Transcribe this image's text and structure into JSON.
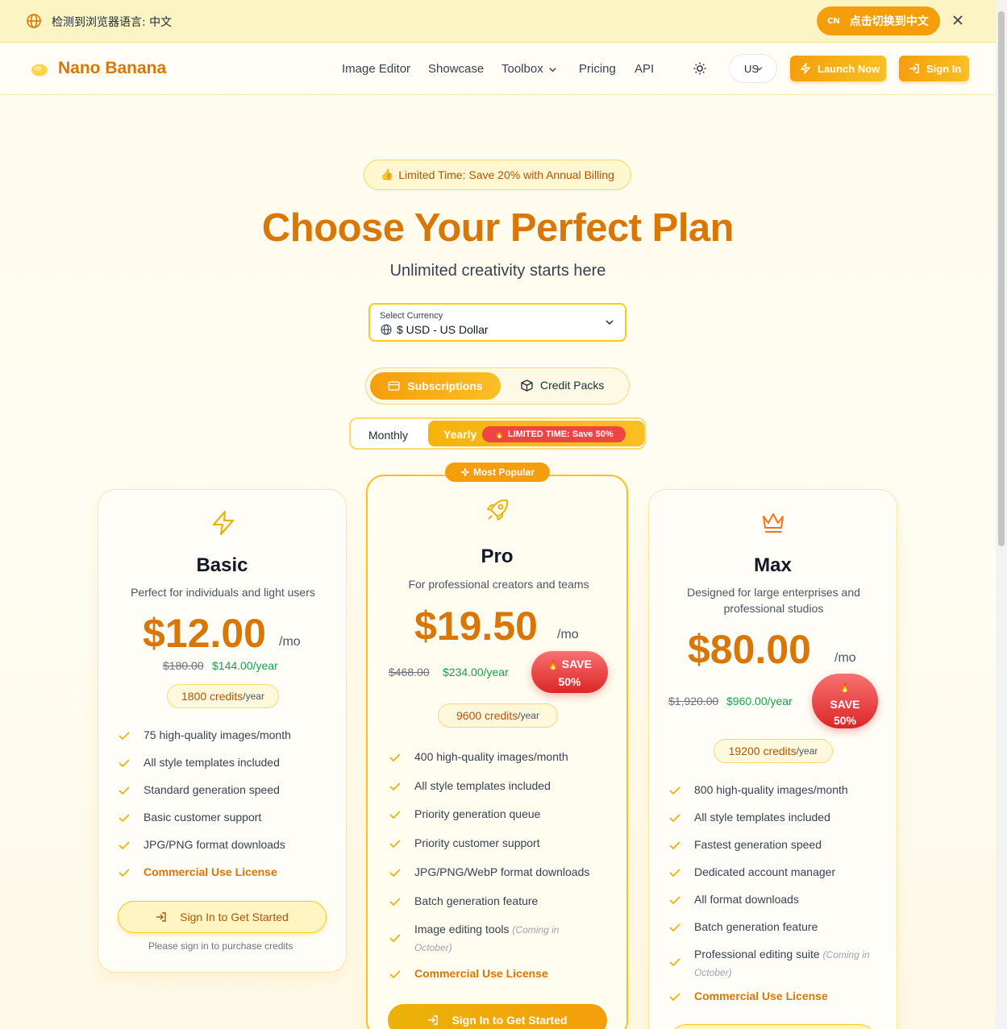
{
  "banner": {
    "text": "检测到浏览器语言: 中文",
    "switch_code": "CN",
    "switch_label": "点击切换到中文"
  },
  "header": {
    "brand": "Nano Banana",
    "nav": [
      "Image Editor",
      "Showcase",
      "Toolbox",
      "Pricing",
      "API"
    ],
    "lang_value": "US",
    "launch_label": "Launch Now",
    "signin_label": "Sign In"
  },
  "hero": {
    "promo": "Limited Time: Save 20% with Annual Billing",
    "title": "Choose Your Perfect Plan",
    "subtitle": "Unlimited creativity starts here",
    "currency_label": "Select Currency",
    "currency_value": "$ USD - US Dollar",
    "tab_subscriptions": "Subscriptions",
    "tab_credit_packs": "Credit Packs",
    "billing_monthly": "Monthly",
    "billing_yearly": "Yearly",
    "yearly_badge": "LIMITED TIME: Save 50%"
  },
  "plans": {
    "basic": {
      "name": "Basic",
      "desc": "Perfect for individuals and light users",
      "price": "$12.00",
      "per": "/mo",
      "old_price": "$180.00",
      "year_price": "$144.00/year",
      "credits": "1800 credits",
      "credits_unit": "/year",
      "features": [
        "75 high-quality images/month",
        "All style templates included",
        "Standard generation speed",
        "Basic customer support",
        "JPG/PNG format downloads",
        "Commercial Use License"
      ],
      "cta": "Sign In to Get Started",
      "note": "Please sign in to purchase credits"
    },
    "pro": {
      "badge": "Most Popular",
      "name": "Pro",
      "desc": "For professional creators and teams",
      "price": "$19.50",
      "per": "/mo",
      "old_price": "$468.00",
      "year_price": "$234.00/year",
      "save_line1": "SAVE",
      "save_line2": "50%",
      "credits": "9600 credits",
      "credits_unit": "/year",
      "features": [
        "400 high-quality images/month",
        "All style templates included",
        "Priority generation queue",
        "Priority customer support",
        "JPG/PNG/WebP format downloads",
        "Batch generation feature",
        "Image editing tools",
        "Commercial Use License"
      ],
      "soon": "(Coming in",
      "soon2": "October)",
      "cta": "Sign In to Get Started"
    },
    "max": {
      "name": "Max",
      "desc1": "Designed for large enterprises and",
      "desc2": "professional studios",
      "price": "$80.00",
      "per": "/mo",
      "old_price": "$1,920.00",
      "year_price": "$960.00/year",
      "save_line1": "SAVE",
      "save_line2": "50%",
      "credits": "19200 credits",
      "credits_unit": "/year",
      "features": [
        "800 high-quality images/month",
        "All style templates included",
        "Fastest generation speed",
        "Dedicated account manager",
        "All format downloads",
        "Batch generation feature",
        "Professional editing suite",
        "Commercial Use License"
      ],
      "soon": "(Coming in",
      "soon2": "October)"
    }
  },
  "colors": {
    "accent": "#f59e0b",
    "brand": "#d97706",
    "save_badge": "#ef4444",
    "year_price": "#16a34a"
  }
}
